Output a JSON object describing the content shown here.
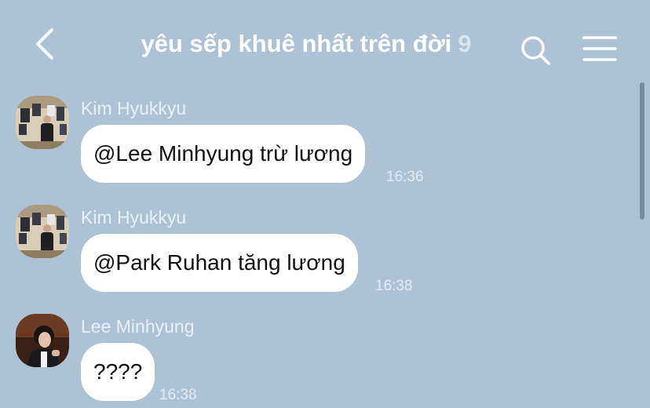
{
  "header": {
    "title": "yêu sếp khuê nhất trên đời",
    "member_count": "9",
    "back_icon": "chevron-left-icon",
    "search_icon": "search-icon",
    "menu_icon": "hamburger-menu-icon"
  },
  "colors": {
    "background": "#aec2d5",
    "bubble": "#ffffff",
    "header_text": "#ffffff"
  },
  "messages": [
    {
      "sender": "Kim Hyukkyu",
      "text": "@Lee Minhyung trừ lương",
      "time": "16:36"
    },
    {
      "sender": "Kim Hyukkyu",
      "text": "@Park Ruhan tăng lương",
      "time": "16:38"
    },
    {
      "sender": "Lee Minhyung",
      "text": "????",
      "time": "16:38"
    }
  ]
}
